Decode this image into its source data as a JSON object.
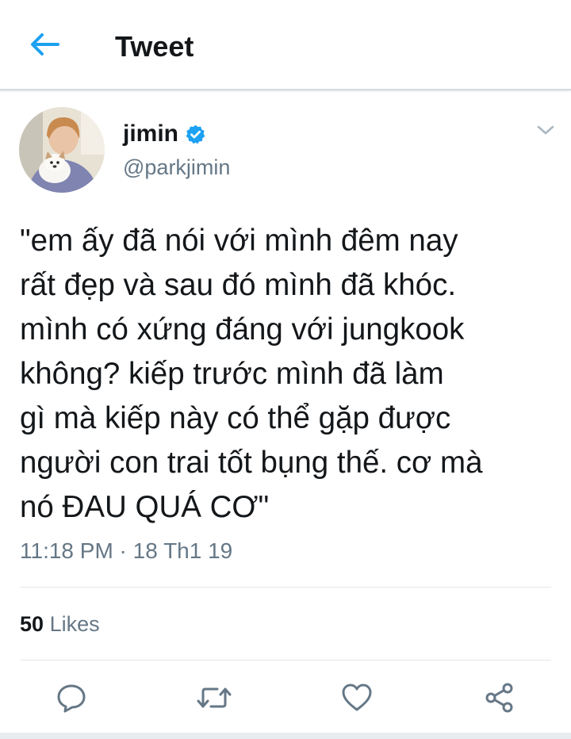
{
  "header": {
    "title": "Tweet",
    "back_icon": "arrow-left-icon",
    "accent": "#1da1f2"
  },
  "author": {
    "display_name": "jimin",
    "handle": "@parkjimin",
    "verified_icon": "verified-badge-icon",
    "avatar_icon": "avatar-image"
  },
  "tweet": {
    "lines": [
      "\"em ấy đã nói với mình đêm nay",
      "rất đẹp và sau đó mình đã khóc.",
      "mình có xứng đáng với jungkook",
      "không? kiếp trước mình đã làm",
      "gì mà kiếp này có thể gặp được",
      "người con trai tốt bụng thế. cơ mà",
      "nó ĐAU QUÁ CƠ\""
    ],
    "timestamp": "11:18 PM · 18 Th1 19"
  },
  "stats": {
    "likes_count": "50",
    "likes_label": "Likes"
  },
  "actions": [
    {
      "name": "reply",
      "icon": "reply-icon"
    },
    {
      "name": "retweet",
      "icon": "retweet-icon"
    },
    {
      "name": "like",
      "icon": "heart-icon"
    },
    {
      "name": "share",
      "icon": "share-icon"
    }
  ],
  "colors": {
    "text": "#14171a",
    "muted": "#657786",
    "divider": "#e1e8ed",
    "verified": "#1da1f2"
  }
}
